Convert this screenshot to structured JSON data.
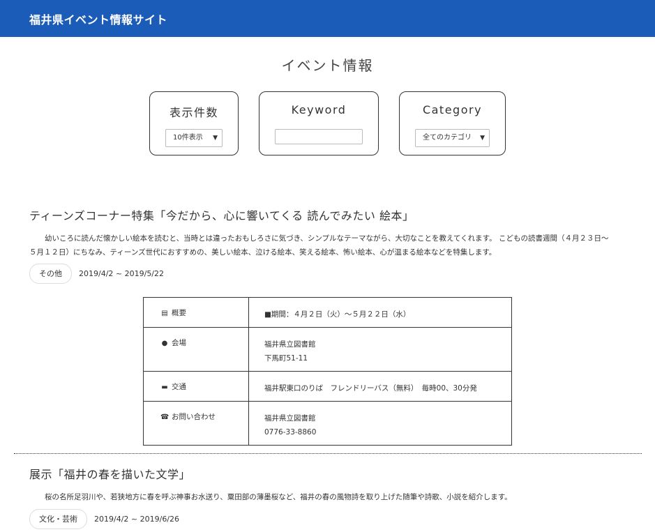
{
  "header": {
    "site_title": "福井県イベント情報サイト"
  },
  "page": {
    "title": "イベント情報"
  },
  "filters": {
    "count": {
      "label": "表示件数",
      "selected": "10件表示"
    },
    "keyword": {
      "label": "Keyword",
      "value": ""
    },
    "category": {
      "label": "Category",
      "selected": "全てのカテゴリ"
    }
  },
  "events": [
    {
      "title": "ティーンズコーナー特集「今だから、心に響いてくる 読んでみたい 絵本」",
      "description": "幼いころに読んだ懐かしい絵本を読むと、当時とは違ったおもしろさに気づき、シンプルなテーマながら、大切なことを教えてくれます。 こどもの読書週間（４月２３日～５月１２日）にちなみ、ティーンズ世代におすすめの、美しい絵本、泣ける絵本、笑える絵本、怖い絵本、心が温まる絵本などを特集します。",
      "category": "その他",
      "dates": "2019/4/2 ~ 2019/5/22",
      "details": {
        "overview_label": "概要",
        "overview_value": "■期間：４月２日（火）～５月２２日（水）",
        "venue_label": "会場",
        "venue_name": "福井県立図書館",
        "venue_address": "下馬町51-11",
        "access_label": "交通",
        "access_value": "福井駅東口のりば　フレンドリーバス（無料）　毎時00、30分発",
        "contact_label": "お問い合わせ",
        "contact_name": "福井県立図書館",
        "contact_phone": "0776-33-8860"
      }
    },
    {
      "title": "展示「福井の春を描いた文学」",
      "description": "桜の名所足羽川や、若狭地方に春を呼ぶ神事お水送り、粟田部の薄墨桜など、福井の春の風物詩を取り上げた随筆や詩歌、小説を紹介します。",
      "category": "文化・芸術",
      "dates": "2019/4/2 ~ 2019/6/26"
    }
  ],
  "icons": [
    "document-icon",
    "map-marker-icon",
    "car-icon",
    "phone-icon",
    "chevron-down-icon"
  ],
  "colors": {
    "header_bg": "#1b5cb8",
    "header_text": "#ffffff",
    "text": "#333333"
  }
}
